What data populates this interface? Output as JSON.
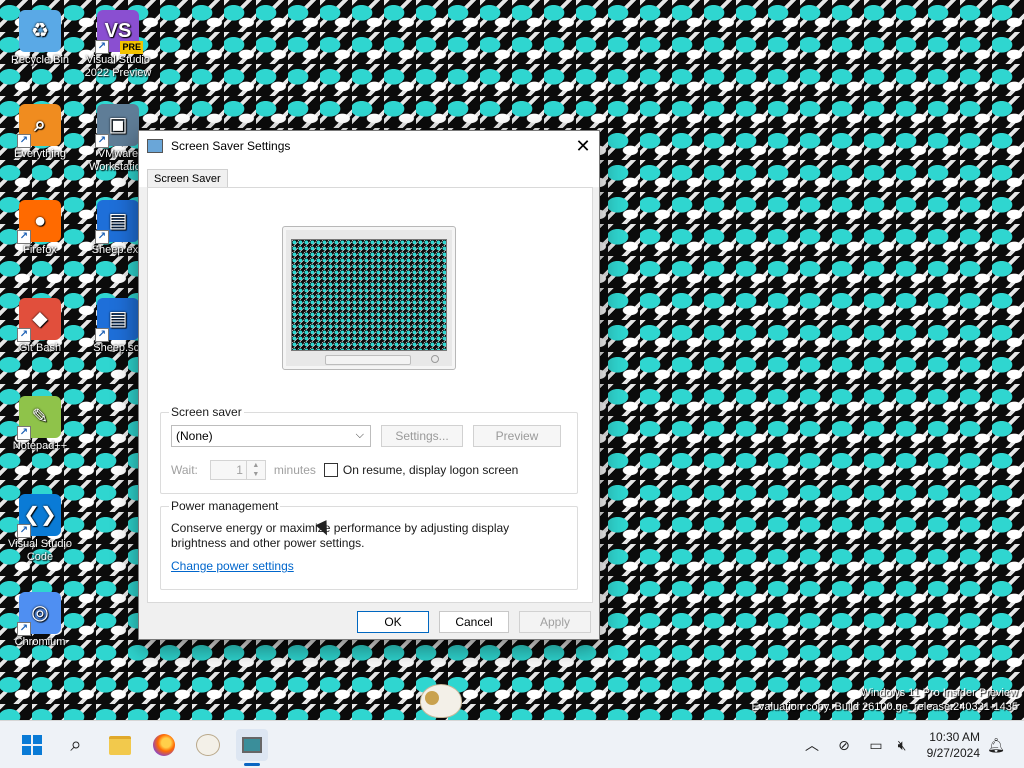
{
  "desktop": {
    "icons": [
      {
        "label": "Recycle Bin",
        "icon": "recycle-bin-icon",
        "color": "#5aa9e6",
        "glyph": "♻"
      },
      {
        "label": "Visual Studio 2022 Preview",
        "icon": "visual-studio-icon",
        "color": "#8a4fd1",
        "glyph": "VS",
        "badge": "PRE"
      },
      {
        "label": "Everything",
        "icon": "everything-search-icon",
        "color": "#f08c1f",
        "glyph": "⌕"
      },
      {
        "label": "VMware Workstation",
        "icon": "vmware-icon",
        "color": "#5f7d97",
        "glyph": "▣"
      },
      {
        "label": "Firefox",
        "icon": "firefox-icon",
        "color": "#ff6a00",
        "glyph": "●"
      },
      {
        "label": "Sheep.exe",
        "icon": "sheep-exe-file-icon",
        "color": "#1e6fd9",
        "glyph": "▤"
      },
      {
        "label": "Git Bash",
        "icon": "git-bash-icon",
        "color": "#e14f3c",
        "glyph": "◆"
      },
      {
        "label": "Sheep.scr",
        "icon": "sheep-scr-file-icon",
        "color": "#1e6fd9",
        "glyph": "▤"
      },
      {
        "label": "Notepad++",
        "icon": "notepad-plus-plus-icon",
        "color": "#8fc34a",
        "glyph": "✎"
      },
      {
        "label": "Visual Studio Code",
        "icon": "vscode-icon",
        "color": "#0a7bd6",
        "glyph": "❮❯"
      },
      {
        "label": "Chromium",
        "icon": "chromium-icon",
        "color": "#4f8ff2",
        "glyph": "◎"
      }
    ]
  },
  "dialog": {
    "title": "Screen Saver Settings",
    "tab": "Screen Saver",
    "screensaver_group": {
      "label": "Screen saver",
      "selected": "(None)",
      "settings_button": "Settings...",
      "preview_button": "Preview",
      "wait_label": "Wait:",
      "wait_value": "1",
      "minutes_label": "minutes",
      "resume_label": "On resume, display logon screen",
      "resume_checked": false
    },
    "power_group": {
      "label": "Power management",
      "text": "Conserve energy or maximize performance by adjusting display brightness and other power settings.",
      "link": "Change power settings"
    },
    "buttons": {
      "ok": "OK",
      "cancel": "Cancel",
      "apply": "Apply"
    }
  },
  "watermark": {
    "line1": "Windows 11 Pro Insider Preview",
    "line2": "Evaluation copy. Build 26100.ge_release.240331-1435"
  },
  "taskbar": {
    "apps": [
      "start",
      "search",
      "file-explorer",
      "firefox",
      "sheep",
      "screen-saver-settings"
    ],
    "clock": {
      "time": "10:30 AM",
      "date": "9/27/2024"
    }
  },
  "colors": {
    "accent": "#0067c0",
    "link": "#0066cc",
    "wallpaper_cyan": "#2fd6d0"
  }
}
